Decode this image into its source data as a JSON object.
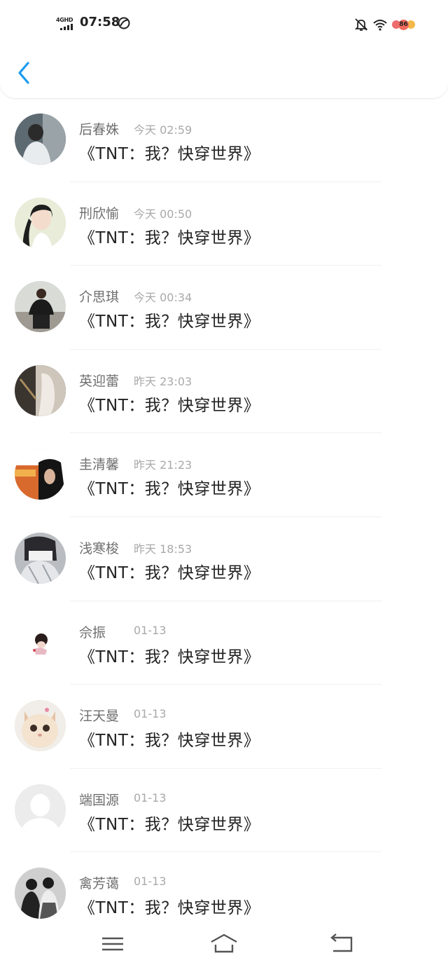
{
  "status_bar": {
    "network": "4GHD",
    "time": "07:58",
    "battery": "86"
  },
  "messages": [
    {
      "name": "后春姝",
      "time": "今天 02:59",
      "text": "《TNT：我？快穿世界》"
    },
    {
      "name": "刑欣愉",
      "time": "今天 00:50",
      "text": "《TNT：我？快穿世界》"
    },
    {
      "name": "介思琪",
      "time": "今天 00:34",
      "text": "《TNT：我？快穿世界》"
    },
    {
      "name": "英迎蕾",
      "time": "昨天 23:03",
      "text": "《TNT：我？快穿世界》"
    },
    {
      "name": "圭清馨",
      "time": "昨天 21:23",
      "text": "《TNT：我？快穿世界》"
    },
    {
      "name": "浅寒梭",
      "time": "昨天 18:53",
      "text": "《TNT：我？快穿世界》"
    },
    {
      "name": "佘振",
      "time": "01-13",
      "text": "《TNT：我？快穿世界》"
    },
    {
      "name": "汪天曼",
      "time": "01-13",
      "text": "《TNT：我？快穿世界》"
    },
    {
      "name": "端国源",
      "time": "01-13",
      "text": "《TNT：我？快穿世界》"
    },
    {
      "name": "禽芳蔼",
      "time": "01-13",
      "text": "《TNT：我？快穿世界》"
    }
  ],
  "colors": {
    "accent": "#1a9bf0",
    "name_text": "#6f6f6f",
    "time_text": "#a9a9a9",
    "message_text": "#222222"
  },
  "icons": {
    "back": "chevron-left-icon",
    "menu": "menu-icon",
    "home": "home-icon",
    "return": "back-arrow-icon"
  }
}
